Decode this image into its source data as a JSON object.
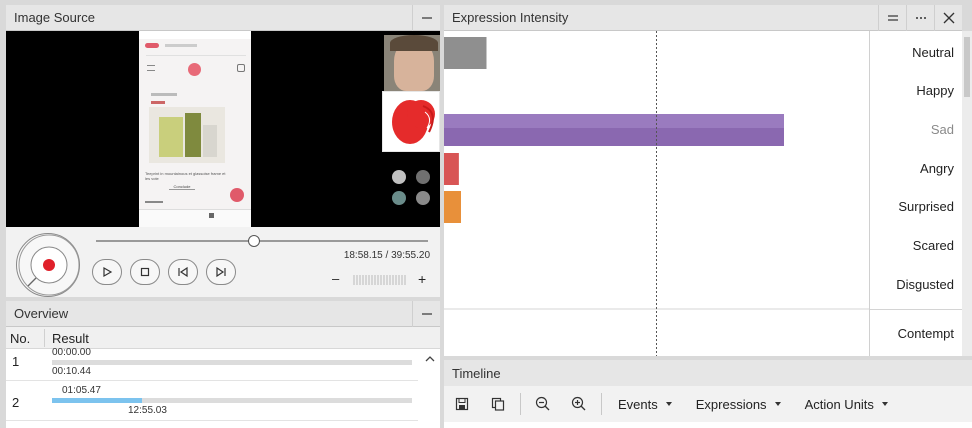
{
  "image_source": {
    "title": "Image Source",
    "time_display": "18:58.15 / 39:55.20",
    "minus": "–",
    "plus": "+",
    "phone_caption": "Teeprint in mountainous et glassoise frame et les vote",
    "phone_button": "Conclude",
    "progress_fraction": 0.475
  },
  "overview": {
    "title": "Overview",
    "columns": [
      "No.",
      "Result"
    ],
    "rows": [
      {
        "no": "1",
        "start": "00:00.00",
        "end": "00:10.44",
        "fill_start": 0.0,
        "fill_end": 0.0
      },
      {
        "no": "2",
        "start": "01:05.47",
        "end": "12:55.03",
        "fill_start": 0.0,
        "fill_end": 0.25
      }
    ]
  },
  "expression": {
    "title": "Expression Intensity",
    "labels": [
      {
        "name": "Neutral",
        "muted": false
      },
      {
        "name": "Happy",
        "muted": false
      },
      {
        "name": "Sad",
        "muted": true
      },
      {
        "name": "Angry",
        "muted": false
      },
      {
        "name": "Surprised",
        "muted": false
      },
      {
        "name": "Scared",
        "muted": false
      },
      {
        "name": "Disgusted",
        "muted": false
      },
      {
        "name": "Contempt",
        "muted": false
      }
    ]
  },
  "chart_data": {
    "type": "bar",
    "orientation": "horizontal",
    "title": "Expression Intensity",
    "categories": [
      "Neutral",
      "Happy",
      "Sad",
      "Angry",
      "Surprised",
      "Scared",
      "Disgusted",
      "Contempt"
    ],
    "values": [
      0.1,
      0.0,
      0.8,
      0.035,
      0.04,
      0.0,
      0.0,
      0.0
    ],
    "colors": [
      "#8f8f8f",
      "#f0d050",
      "#8a68b0",
      "#d85555",
      "#e8903a",
      "#50a0d0",
      "#60b060",
      "#a0a0a0"
    ],
    "xlim": [
      0,
      1
    ],
    "reference_line": 0.5
  },
  "timeline": {
    "title": "Timeline",
    "events_label": "Events",
    "expressions_label": "Expressions",
    "action_units_label": "Action Units"
  },
  "colors": {
    "record_red": "#e0202a",
    "progress_blue": "#7cc3ee"
  }
}
